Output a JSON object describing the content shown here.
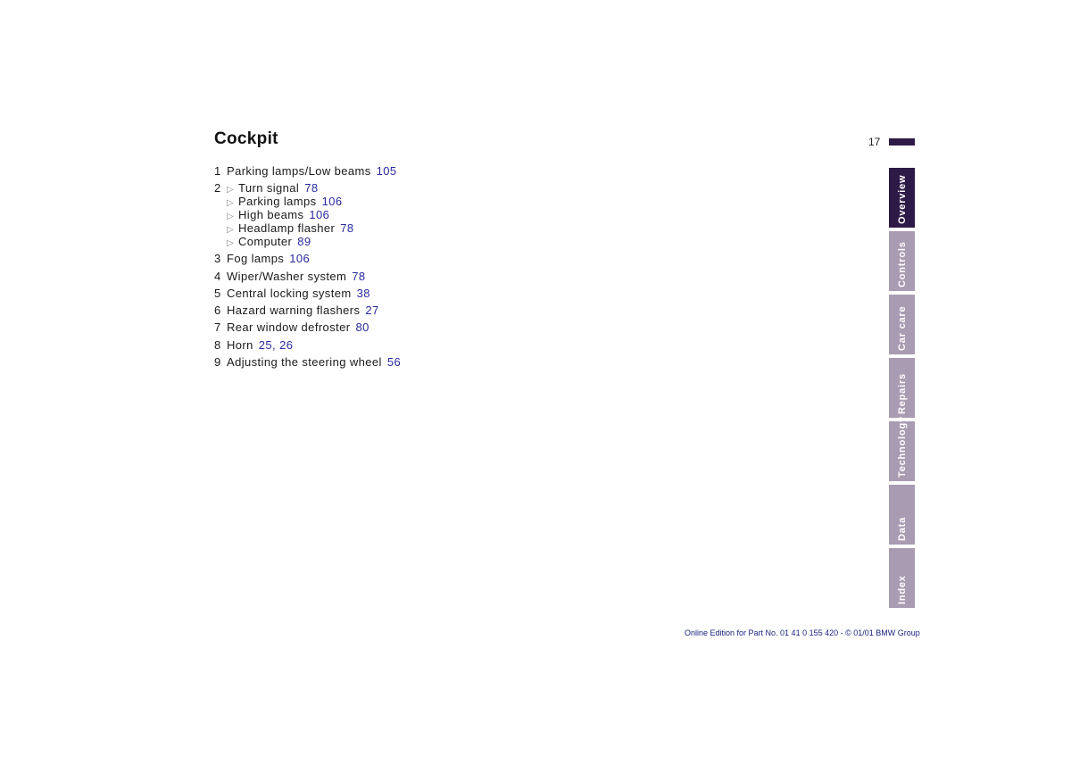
{
  "page": {
    "title": "Cockpit",
    "page_number": "17"
  },
  "items": [
    {
      "num": "1",
      "label": "Parking lamps/Low beams",
      "refs": "105"
    },
    {
      "num": "2",
      "subitems": [
        {
          "label": "Turn signal",
          "refs": "78"
        },
        {
          "label": "Parking lamps",
          "refs": "106"
        },
        {
          "label": "High beams",
          "refs": "106"
        },
        {
          "label": "Headlamp flasher",
          "refs": "78"
        },
        {
          "label": "Computer",
          "refs": "89"
        }
      ]
    },
    {
      "num": "3",
      "label": "Fog lamps",
      "refs": "106"
    },
    {
      "num": "4",
      "label": "Wiper/Washer system",
      "refs": "78"
    },
    {
      "num": "5",
      "label": "Central locking system",
      "refs": "38"
    },
    {
      "num": "6",
      "label": "Hazard warning flashers",
      "refs": "27"
    },
    {
      "num": "7",
      "label": "Rear window defroster",
      "refs": "80"
    },
    {
      "num": "8",
      "label": "Horn",
      "refs": "25, 26"
    },
    {
      "num": "9",
      "label": "Adjusting the steering wheel",
      "refs": "56"
    }
  ],
  "side_tabs": [
    {
      "label": "Overview",
      "active": true
    },
    {
      "label": "Controls",
      "active": false
    },
    {
      "label": "Car care",
      "active": false
    },
    {
      "label": "Repairs",
      "active": false
    },
    {
      "label": "Technology",
      "active": false
    },
    {
      "label": "Data",
      "active": false
    },
    {
      "label": "Index",
      "active": false
    }
  ],
  "footer": "Online Edition for Part No. 01 41 0 155 420 - © 01/01 BMW Group",
  "colors": {
    "tab_active": "#2e1a47",
    "tab_inactive": "#a99bb2",
    "link": "#2a2aa0"
  }
}
